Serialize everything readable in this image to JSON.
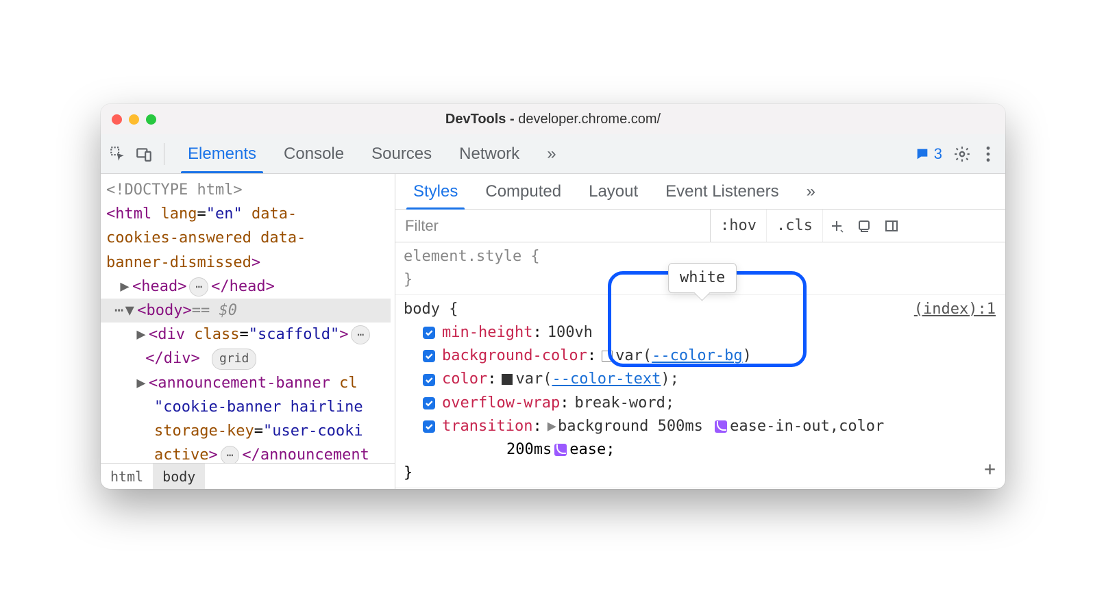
{
  "window": {
    "title_prefix": "DevTools - ",
    "title_url": "developer.chrome.com/"
  },
  "main_tabs": [
    "Elements",
    "Console",
    "Sources",
    "Network"
  ],
  "main_tabs_overflow": "»",
  "issues_count": "3",
  "dom": {
    "doctype": "<!DOCTYPE html>",
    "html_open": "<html lang=\"en\" data-cookies-answered data-banner-dismissed>",
    "head": "<head>",
    "head_close": "</head>",
    "body": "<body>",
    "body_suffix": " == $0",
    "div_scaffold_open": "<div class=\"scaffold\">",
    "div_scaffold_close": "</div>",
    "grid_badge": "grid",
    "announcement": "<announcement-banner class=\"cookie-banner hairline\" storage-key=\"user-cookie\" active>",
    "announcement_close": "</announcement-"
  },
  "crumbs": [
    "html",
    "body"
  ],
  "sub_tabs": [
    "Styles",
    "Computed",
    "Layout",
    "Event Listeners"
  ],
  "sub_tabs_overflow": "»",
  "filter_placeholder": "Filter",
  "filter_buttons": {
    "hov": ":hov",
    "cls": ".cls"
  },
  "rules": {
    "element_style": "element.style {",
    "element_style_close": "}",
    "body_selector": "body {",
    "body_close": "}",
    "source": "(index):1",
    "props": [
      {
        "name": "min-height",
        "value": "100vh"
      },
      {
        "name": "background-color",
        "value_prefix": "var(",
        "var": "--color-bg",
        "value_suffix": ")"
      },
      {
        "name": "color",
        "value_prefix": "var(",
        "var": "--color-text",
        "value_suffix": ");"
      },
      {
        "name": "overflow-wrap",
        "value": "break-word;"
      },
      {
        "name": "transition",
        "value1": "background 500ms",
        "ease1": "ease-in-out",
        "sep": ",color",
        "value2": "200ms",
        "ease2": "ease;"
      }
    ]
  },
  "tooltip": "white"
}
